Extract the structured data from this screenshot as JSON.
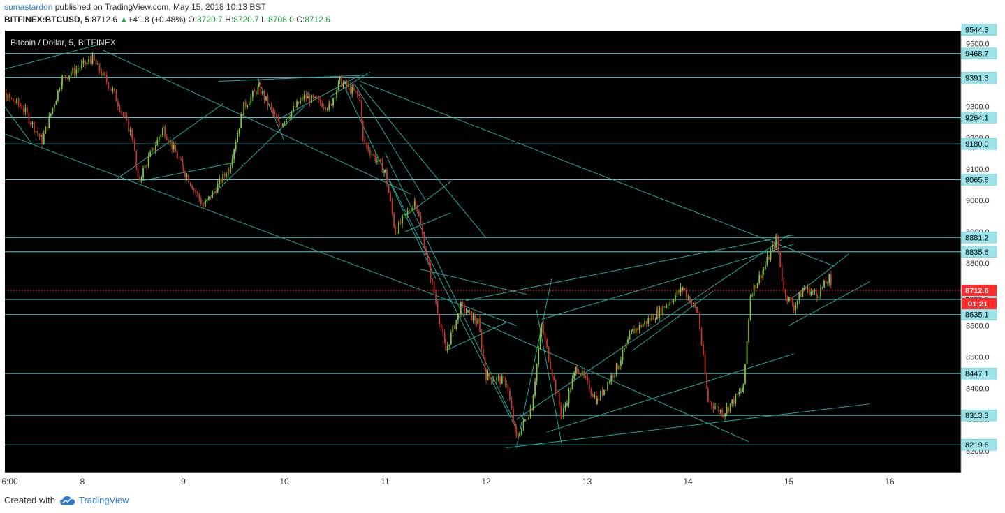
{
  "header": {
    "author": "sumastardon",
    "published_text": "published on TradingView.com, May 15, 2018 10:13 BST",
    "symbol": "BITFINEX:BTCUSD, 5",
    "last": "8712.6",
    "change": "+41.8 (+0.48%)",
    "o_label": "O:",
    "o_value": "8720.7",
    "h_label": "H:",
    "h_value": "8720.7",
    "l_label": "L:",
    "l_value": "8708.0",
    "c_label": "C:",
    "c_value": "8712.6"
  },
  "footer": {
    "created_with": "Created with",
    "brand": "TradingView"
  },
  "colors": {
    "background": "#000000",
    "grid_line": "#5fc8cf",
    "trend_line": "#2aa89a",
    "candle_up": "#7dc241",
    "candle_down": "#c0392b",
    "last_price": "#ff2a2a",
    "label_fill": "#9be3ea"
  },
  "chart_data": {
    "type": "candlestick",
    "title": "Bitcoin / Dollar, 5, BITFINEX",
    "ylim": [
      8180,
      9560
    ],
    "x_ticks": [
      "6:00",
      "8",
      "9",
      "10",
      "11",
      "12",
      "13",
      "14",
      "15",
      "16"
    ],
    "y_ticks": [
      8200.0,
      8300.0,
      8400.0,
      8500.0,
      8600.0,
      8700.0,
      8800.0,
      8900.0,
      9000.0,
      9100.0,
      9200.0,
      9300.0,
      9400.0,
      9500.0
    ],
    "horizontal_levels": [
      9544.3,
      9468.7,
      9391.3,
      9264.1,
      9180.0,
      9065.8,
      8881.2,
      8835.6,
      8683.5,
      8635.1,
      8447.1,
      8313.3,
      8219.6
    ],
    "last_price": 8712.6,
    "countdown": "01:21",
    "price_path": [
      [
        7.0,
        9380
      ],
      [
        7.4,
        9300
      ],
      [
        7.6,
        9190
      ],
      [
        7.8,
        9390
      ],
      [
        8.1,
        9450
      ],
      [
        8.3,
        9350
      ],
      [
        8.5,
        9200
      ],
      [
        8.55,
        9060
      ],
      [
        8.8,
        9230
      ],
      [
        9.0,
        9100
      ],
      [
        9.2,
        8980
      ],
      [
        9.45,
        9100
      ],
      [
        9.6,
        9300
      ],
      [
        9.75,
        9360
      ],
      [
        9.95,
        9240
      ],
      [
        10.2,
        9330
      ],
      [
        10.45,
        9300
      ],
      [
        10.55,
        9380
      ],
      [
        10.75,
        9330
      ],
      [
        10.78,
        9190
      ],
      [
        11.0,
        9090
      ],
      [
        11.1,
        8900
      ],
      [
        11.3,
        9000
      ],
      [
        11.45,
        8760
      ],
      [
        11.6,
        8520
      ],
      [
        11.75,
        8660
      ],
      [
        11.92,
        8610
      ],
      [
        12.0,
        8440
      ],
      [
        12.2,
        8420
      ],
      [
        12.3,
        8240
      ],
      [
        12.45,
        8340
      ],
      [
        12.55,
        8600
      ],
      [
        12.75,
        8310
      ],
      [
        12.9,
        8470
      ],
      [
        13.1,
        8360
      ],
      [
        13.3,
        8470
      ],
      [
        13.45,
        8580
      ],
      [
        13.7,
        8640
      ],
      [
        13.95,
        8720
      ],
      [
        14.1,
        8640
      ],
      [
        14.2,
        8360
      ],
      [
        14.35,
        8320
      ],
      [
        14.55,
        8400
      ],
      [
        14.62,
        8700
      ],
      [
        14.75,
        8780
      ],
      [
        14.88,
        8880
      ],
      [
        14.95,
        8710
      ],
      [
        15.05,
        8660
      ],
      [
        15.15,
        8720
      ],
      [
        15.28,
        8700
      ],
      [
        15.4,
        8750
      ],
      [
        15.42,
        8712.6
      ]
    ],
    "trend_lines": [
      [
        [
          7.0,
          9400
        ],
        [
          8.2,
          9500
        ]
      ],
      [
        [
          7.0,
          9400
        ],
        [
          7.5,
          9180
        ]
      ],
      [
        [
          7.0,
          9240
        ],
        [
          12.3,
          8600
        ]
      ],
      [
        [
          8.2,
          9480
        ],
        [
          11.25,
          9020
        ]
      ],
      [
        [
          8.35,
          9070
        ],
        [
          9.4,
          9310
        ]
      ],
      [
        [
          8.55,
          9060
        ],
        [
          9.5,
          9120
        ]
      ],
      [
        [
          9.2,
          8990
        ],
        [
          10.2,
          9300
        ]
      ],
      [
        [
          9.95,
          9260
        ],
        [
          10.75,
          9400
        ]
      ],
      [
        [
          9.35,
          9380
        ],
        [
          10.85,
          9400
        ]
      ],
      [
        [
          9.75,
          9380
        ],
        [
          10.0,
          9190
        ]
      ],
      [
        [
          10.6,
          9360
        ],
        [
          11.5,
          8750
        ]
      ],
      [
        [
          10.7,
          9370
        ],
        [
          11.4,
          9000
        ]
      ],
      [
        [
          10.45,
          9330
        ],
        [
          10.85,
          9410
        ]
      ],
      [
        [
          10.75,
          9370
        ],
        [
          12.0,
          8880
        ]
      ],
      [
        [
          11.05,
          9060
        ],
        [
          12.3,
          8270
        ]
      ],
      [
        [
          11.0,
          9150
        ],
        [
          12.3,
          8280
        ]
      ],
      [
        [
          11.35,
          8780
        ],
        [
          12.4,
          8700
        ]
      ],
      [
        [
          11.6,
          8520
        ],
        [
          12.2,
          8610
        ]
      ],
      [
        [
          11.2,
          8950
        ],
        [
          11.65,
          9060
        ]
      ],
      [
        [
          11.2,
          8900
        ],
        [
          11.65,
          8960
        ]
      ],
      [
        [
          10.75,
          9380
        ],
        [
          15.45,
          8790
        ]
      ],
      [
        [
          12.2,
          8210
        ],
        [
          15.8,
          8350
        ]
      ],
      [
        [
          12.3,
          8210
        ],
        [
          12.65,
          8750
        ]
      ],
      [
        [
          12.5,
          8650
        ],
        [
          12.75,
          8220
        ]
      ],
      [
        [
          12.55,
          8620
        ],
        [
          15.05,
          8860
        ]
      ],
      [
        [
          12.3,
          8300
        ],
        [
          15.0,
          8890
        ]
      ],
      [
        [
          11.8,
          8680
        ],
        [
          15.05,
          8890
        ]
      ],
      [
        [
          11.95,
          8610
        ],
        [
          14.6,
          8230
        ]
      ],
      [
        [
          12.6,
          8260
        ],
        [
          15.05,
          8510
        ]
      ],
      [
        [
          13.45,
          8520
        ],
        [
          14.25,
          8710
        ]
      ],
      [
        [
          15.0,
          8600
        ],
        [
          15.8,
          8740
        ]
      ],
      [
        [
          15.0,
          8680
        ],
        [
          15.6,
          8830
        ]
      ]
    ]
  }
}
